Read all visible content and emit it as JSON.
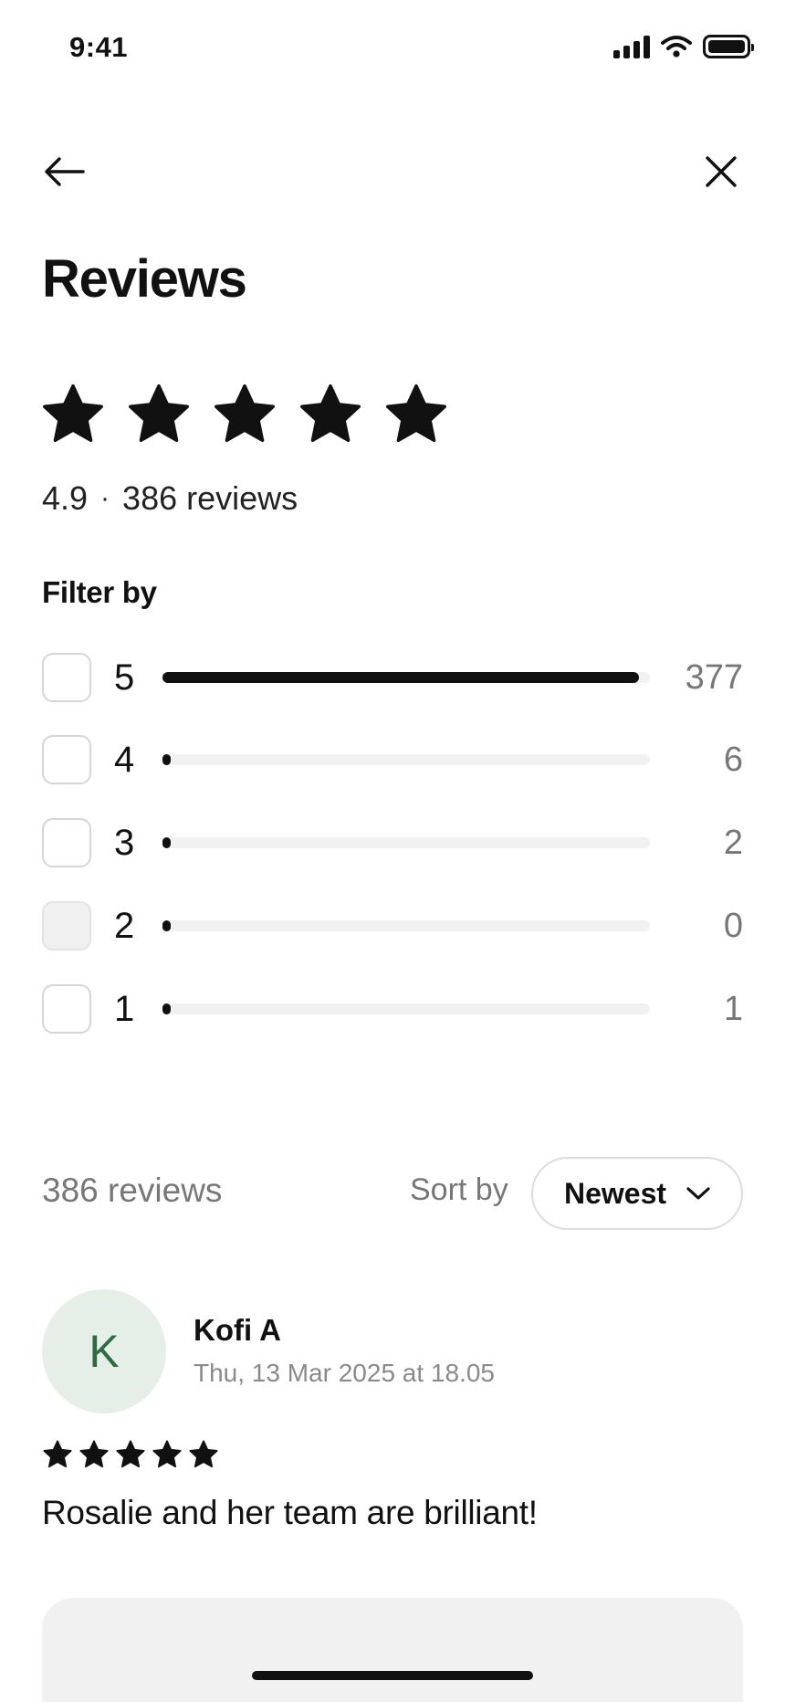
{
  "status_bar": {
    "time": "9:41"
  },
  "header": {
    "title": "Reviews"
  },
  "summary": {
    "rating": "4.9",
    "separator": "·",
    "reviews_label": "386 reviews",
    "stars": 5
  },
  "filter": {
    "title": "Filter by",
    "rows": [
      {
        "stars": "5",
        "count": "377",
        "fraction": 0.978,
        "disabled": false
      },
      {
        "stars": "4",
        "count": "6",
        "fraction": 0.016,
        "disabled": false
      },
      {
        "stars": "3",
        "count": "2",
        "fraction": 0.005,
        "disabled": false
      },
      {
        "stars": "2",
        "count": "0",
        "fraction": 0.0,
        "disabled": true
      },
      {
        "stars": "1",
        "count": "1",
        "fraction": 0.003,
        "disabled": false
      }
    ]
  },
  "list_header": {
    "reviews_count": "386 reviews",
    "sort_label": "Sort by",
    "sort_value": "Newest"
  },
  "reviews": [
    {
      "avatar_initial": "K",
      "name": "Kofi A",
      "date": "Thu, 13 Mar 2025 at 18.05",
      "stars": 5,
      "text": "Rosalie and her team are brilliant!"
    }
  ],
  "icons": {
    "back": "arrow-left-icon",
    "close": "close-icon",
    "sort": "chevron-down-icon",
    "star": "star-icon"
  },
  "colors": {
    "text": "#111111",
    "muted": "#777777",
    "avatar_bg": "#e6efe7",
    "avatar_text": "#2e6b43",
    "track": "#f1f1f1"
  }
}
